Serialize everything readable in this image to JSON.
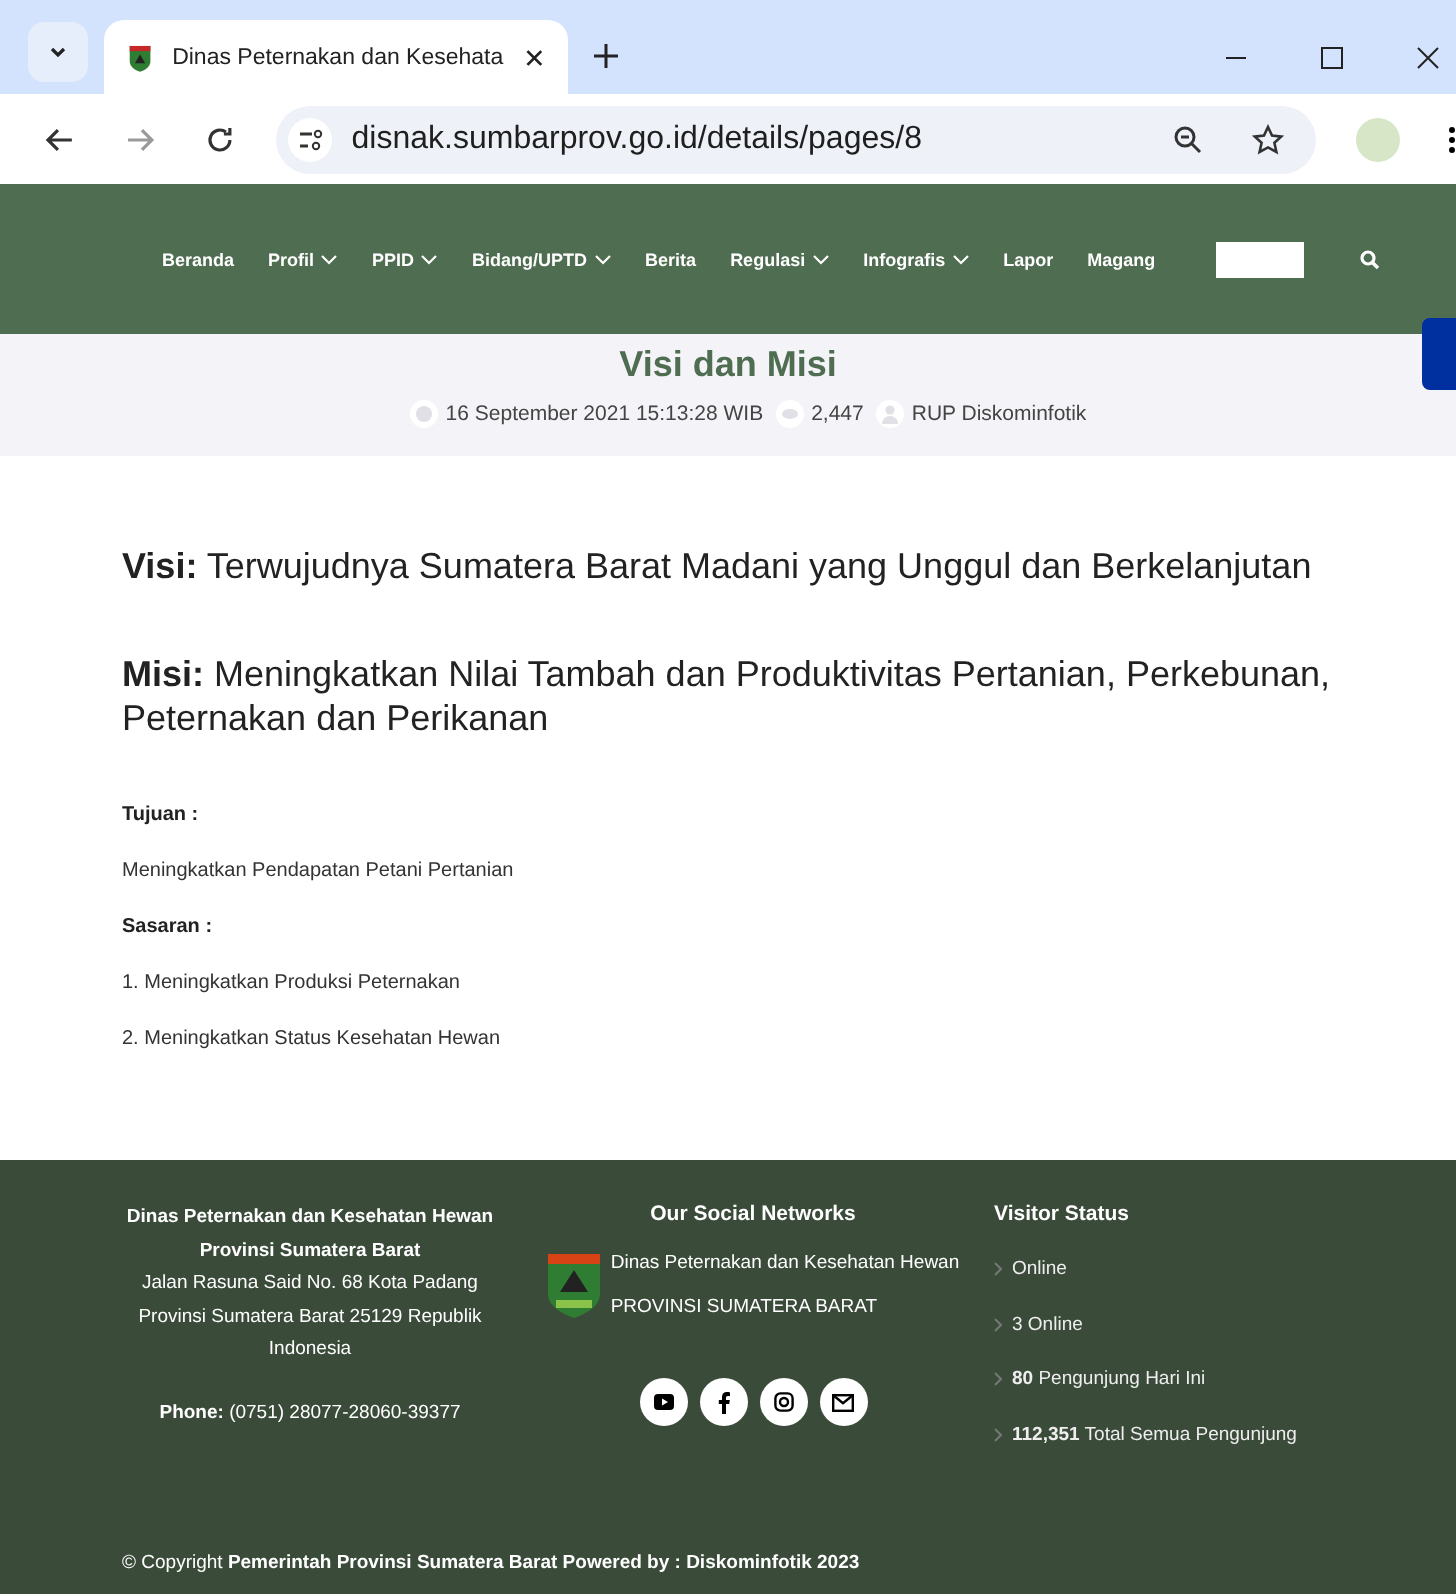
{
  "browser": {
    "tab_title": "Dinas Peternakan dan Kesehata",
    "url": "disnak.sumbarprov.go.id/details/pages/8"
  },
  "nav": {
    "items": [
      {
        "label": "Beranda",
        "has_dropdown": false
      },
      {
        "label": "Profil",
        "has_dropdown": true
      },
      {
        "label": "PPID",
        "has_dropdown": true
      },
      {
        "label": "Bidang/UPTD",
        "has_dropdown": true
      },
      {
        "label": "Berita",
        "has_dropdown": false
      },
      {
        "label": "Regulasi",
        "has_dropdown": true
      },
      {
        "label": "Infografis",
        "has_dropdown": true
      },
      {
        "label": "Lapor",
        "has_dropdown": false
      },
      {
        "label": "Magang",
        "has_dropdown": false
      }
    ]
  },
  "page_header": {
    "title": "Visi dan Misi",
    "date": "16 September 2021 15:13:28 WIB",
    "views": "2,447",
    "author": "RUP Diskominfotik"
  },
  "content": {
    "headings": [
      "**Visi:** Terwujudnya Sumatera Barat Madani yang Unggul dan Berkelanjutan",
      "**Misi:** Meningkatkan Nilai Tambah dan Produktivitas Pertanian, Perkebunan, Peternakan dan Perikanan"
    ],
    "tujuan_label": "Tujuan :",
    "tujuan": "Meningkatkan Pendapatan Petani Pertanian",
    "sasaran_label": "Sasaran :",
    "sasaran": [
      "1. Meningkatkan Produksi Peternakan",
      "2. Meningkatkan Status Kesehatan Hewan"
    ]
  },
  "footer": {
    "address": [
      "**Dinas Peternakan dan Kesehatan Hewan**",
      "**Provinsi Sumatera Barat**",
      "Jalan Rasuna Said No. 68 Kota Padang",
      "Provinsi Sumatera Barat 25129 Republik",
      "Indonesia"
    ],
    "phone": "**Phone:** (0751) 28077-28060-39377",
    "social_title": "Our Social Networks",
    "logo_lines": [
      "Dinas Peternakan dan Kesehatan Hewan",
      "PROVINSI SUMATERA BARAT"
    ],
    "social": [
      {
        "kind": "youtube"
      },
      {
        "kind": "facebook"
      },
      {
        "kind": "instagram"
      },
      {
        "kind": "email"
      }
    ],
    "visitor_title": "Visitor Status",
    "visitors": [
      "Online",
      "3 Online",
      "**80** Pengunjung Hari Ini",
      "**112,351** Total Semua Pengunjung"
    ],
    "copyright": "© Copyright **Pemerintah Provinsi Sumatera Barat Powered by : Diskominfotik 2023**"
  }
}
